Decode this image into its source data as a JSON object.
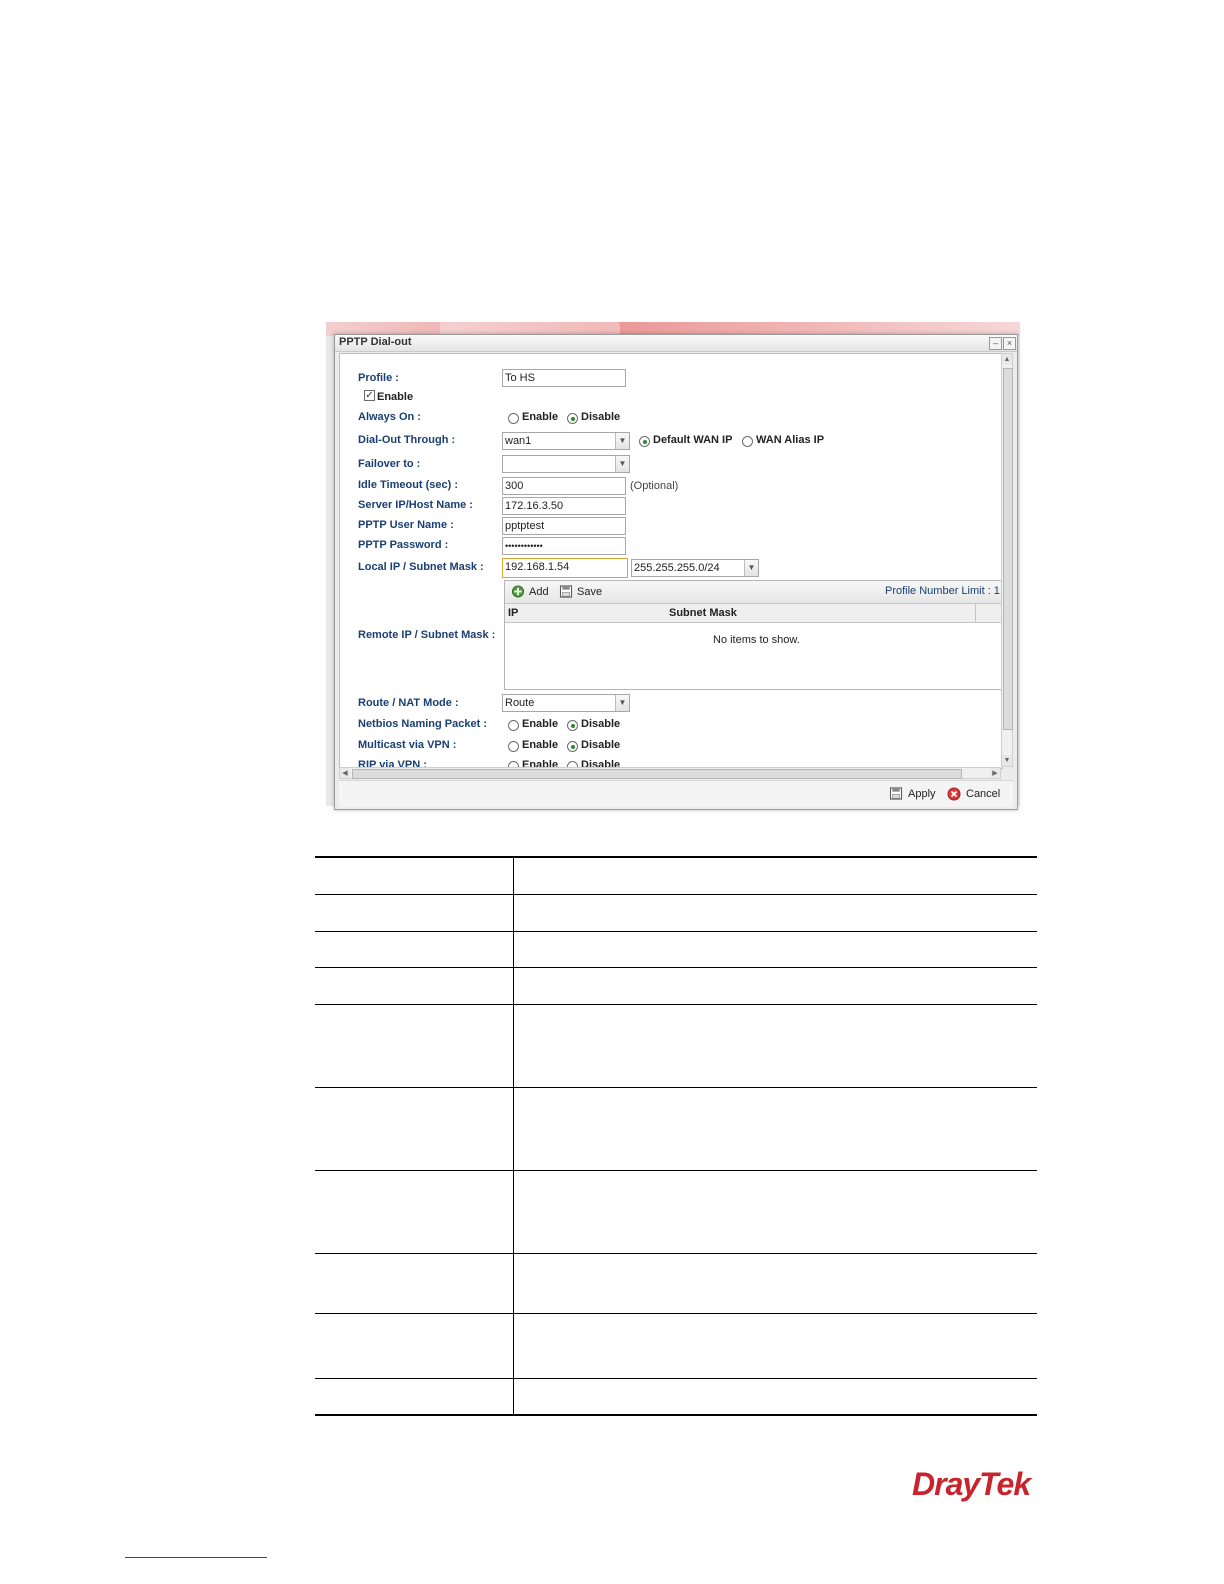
{
  "dialog": {
    "title": "PPTP Dial-out",
    "minimize": "–",
    "close": "×"
  },
  "form": {
    "profile_label": "Profile :",
    "profile_value": "To HS",
    "enable_label": "Enable",
    "always_on_label": "Always On :",
    "radio_enable": "Enable",
    "radio_disable": "Disable",
    "dialout_label": "Dial-Out Through :",
    "dialout_value": "wan1",
    "default_wan_ip": "Default WAN IP",
    "wan_alias_ip": "WAN Alias IP",
    "failover_label": "Failover to :",
    "failover_value": "",
    "idle_label": "Idle Timeout (sec) :",
    "idle_value": "300",
    "optional": "(Optional)",
    "server_label": "Server IP/Host Name :",
    "server_value": "172.16.3.50",
    "user_label": "PPTP User Name :",
    "user_value": "pptptest",
    "password_label": "PPTP Password :",
    "password_value": "••••••••••••",
    "localip_label": "Local IP / Subnet Mask :",
    "localip_value": "192.168.1.54",
    "localmask_value": "255.255.255.0/24",
    "remote_label": "Remote IP / Subnet Mask :",
    "add_label": "Add",
    "save_label": "Save",
    "limit_label": "Profile Number Limit : 1",
    "col_ip": "IP",
    "col_mask": "Subnet Mask",
    "empty_text": "No items to show.",
    "route_label": "Route / NAT Mode :",
    "route_value": "Route",
    "netbios_label": "Netbios Naming Packet :",
    "multicast_label": "Multicast via VPN :",
    "rip_label": "RIP via VPN :"
  },
  "footer": {
    "apply_label": "Apply",
    "cancel_label": "Cancel"
  },
  "logo": "DrayTek",
  "colors": {
    "label_blue": "#1a3f73",
    "logo_red": "#c8242b",
    "radio_green": "#2d8a2d"
  }
}
